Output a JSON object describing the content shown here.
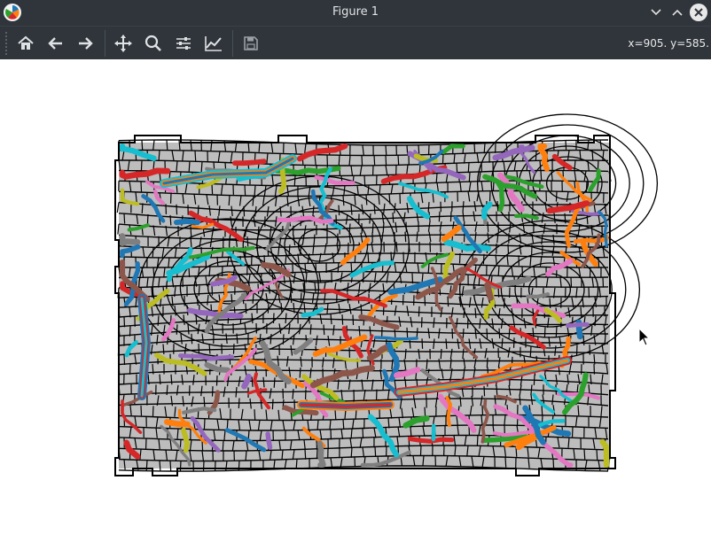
{
  "window": {
    "title": "Figure 1"
  },
  "toolbar": {
    "buttons": [
      {
        "name": "home",
        "icon": "home-icon",
        "tooltip": "Reset original view"
      },
      {
        "name": "back",
        "icon": "arrow-left-icon",
        "tooltip": "Back"
      },
      {
        "name": "forward",
        "icon": "arrow-right-icon",
        "tooltip": "Forward"
      },
      {
        "name": "pan",
        "icon": "move-icon",
        "tooltip": "Pan"
      },
      {
        "name": "zoom",
        "icon": "magnifier-icon",
        "tooltip": "Zoom"
      },
      {
        "name": "subplots",
        "icon": "sliders-icon",
        "tooltip": "Configure subplots"
      },
      {
        "name": "customize",
        "icon": "line-chart-icon",
        "tooltip": "Edit axis"
      },
      {
        "name": "save",
        "icon": "floppy-icon",
        "tooltip": "Save"
      }
    ],
    "coordinates": "x=905. y=585."
  },
  "figure": {
    "background": "#bdbdbd",
    "grid_line_color": "#000000",
    "palette": [
      "#1f77b4",
      "#ff7f0e",
      "#2ca02c",
      "#d62728",
      "#9467bd",
      "#8c564b",
      "#e377c2",
      "#7f7f7f",
      "#bcbd22",
      "#17becf"
    ]
  }
}
